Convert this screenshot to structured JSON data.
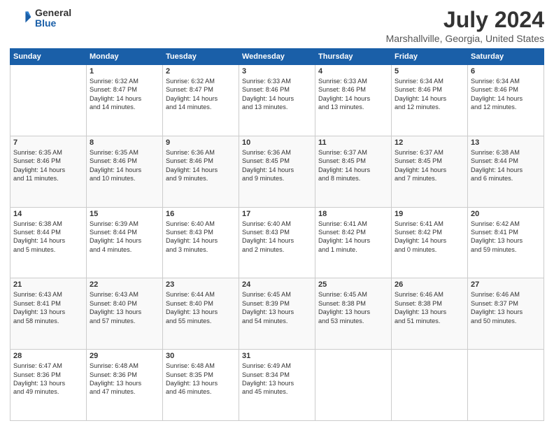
{
  "header": {
    "logo_general": "General",
    "logo_blue": "Blue",
    "title": "July 2024",
    "subtitle": "Marshallville, Georgia, United States"
  },
  "weekdays": [
    "Sunday",
    "Monday",
    "Tuesday",
    "Wednesday",
    "Thursday",
    "Friday",
    "Saturday"
  ],
  "weeks": [
    [
      {
        "day": "",
        "info": ""
      },
      {
        "day": "1",
        "info": "Sunrise: 6:32 AM\nSunset: 8:47 PM\nDaylight: 14 hours\nand 14 minutes."
      },
      {
        "day": "2",
        "info": "Sunrise: 6:32 AM\nSunset: 8:47 PM\nDaylight: 14 hours\nand 14 minutes."
      },
      {
        "day": "3",
        "info": "Sunrise: 6:33 AM\nSunset: 8:46 PM\nDaylight: 14 hours\nand 13 minutes."
      },
      {
        "day": "4",
        "info": "Sunrise: 6:33 AM\nSunset: 8:46 PM\nDaylight: 14 hours\nand 13 minutes."
      },
      {
        "day": "5",
        "info": "Sunrise: 6:34 AM\nSunset: 8:46 PM\nDaylight: 14 hours\nand 12 minutes."
      },
      {
        "day": "6",
        "info": "Sunrise: 6:34 AM\nSunset: 8:46 PM\nDaylight: 14 hours\nand 12 minutes."
      }
    ],
    [
      {
        "day": "7",
        "info": "Sunrise: 6:35 AM\nSunset: 8:46 PM\nDaylight: 14 hours\nand 11 minutes."
      },
      {
        "day": "8",
        "info": "Sunrise: 6:35 AM\nSunset: 8:46 PM\nDaylight: 14 hours\nand 10 minutes."
      },
      {
        "day": "9",
        "info": "Sunrise: 6:36 AM\nSunset: 8:46 PM\nDaylight: 14 hours\nand 9 minutes."
      },
      {
        "day": "10",
        "info": "Sunrise: 6:36 AM\nSunset: 8:45 PM\nDaylight: 14 hours\nand 9 minutes."
      },
      {
        "day": "11",
        "info": "Sunrise: 6:37 AM\nSunset: 8:45 PM\nDaylight: 14 hours\nand 8 minutes."
      },
      {
        "day": "12",
        "info": "Sunrise: 6:37 AM\nSunset: 8:45 PM\nDaylight: 14 hours\nand 7 minutes."
      },
      {
        "day": "13",
        "info": "Sunrise: 6:38 AM\nSunset: 8:44 PM\nDaylight: 14 hours\nand 6 minutes."
      }
    ],
    [
      {
        "day": "14",
        "info": "Sunrise: 6:38 AM\nSunset: 8:44 PM\nDaylight: 14 hours\nand 5 minutes."
      },
      {
        "day": "15",
        "info": "Sunrise: 6:39 AM\nSunset: 8:44 PM\nDaylight: 14 hours\nand 4 minutes."
      },
      {
        "day": "16",
        "info": "Sunrise: 6:40 AM\nSunset: 8:43 PM\nDaylight: 14 hours\nand 3 minutes."
      },
      {
        "day": "17",
        "info": "Sunrise: 6:40 AM\nSunset: 8:43 PM\nDaylight: 14 hours\nand 2 minutes."
      },
      {
        "day": "18",
        "info": "Sunrise: 6:41 AM\nSunset: 8:42 PM\nDaylight: 14 hours\nand 1 minute."
      },
      {
        "day": "19",
        "info": "Sunrise: 6:41 AM\nSunset: 8:42 PM\nDaylight: 14 hours\nand 0 minutes."
      },
      {
        "day": "20",
        "info": "Sunrise: 6:42 AM\nSunset: 8:41 PM\nDaylight: 13 hours\nand 59 minutes."
      }
    ],
    [
      {
        "day": "21",
        "info": "Sunrise: 6:43 AM\nSunset: 8:41 PM\nDaylight: 13 hours\nand 58 minutes."
      },
      {
        "day": "22",
        "info": "Sunrise: 6:43 AM\nSunset: 8:40 PM\nDaylight: 13 hours\nand 57 minutes."
      },
      {
        "day": "23",
        "info": "Sunrise: 6:44 AM\nSunset: 8:40 PM\nDaylight: 13 hours\nand 55 minutes."
      },
      {
        "day": "24",
        "info": "Sunrise: 6:45 AM\nSunset: 8:39 PM\nDaylight: 13 hours\nand 54 minutes."
      },
      {
        "day": "25",
        "info": "Sunrise: 6:45 AM\nSunset: 8:38 PM\nDaylight: 13 hours\nand 53 minutes."
      },
      {
        "day": "26",
        "info": "Sunrise: 6:46 AM\nSunset: 8:38 PM\nDaylight: 13 hours\nand 51 minutes."
      },
      {
        "day": "27",
        "info": "Sunrise: 6:46 AM\nSunset: 8:37 PM\nDaylight: 13 hours\nand 50 minutes."
      }
    ],
    [
      {
        "day": "28",
        "info": "Sunrise: 6:47 AM\nSunset: 8:36 PM\nDaylight: 13 hours\nand 49 minutes."
      },
      {
        "day": "29",
        "info": "Sunrise: 6:48 AM\nSunset: 8:36 PM\nDaylight: 13 hours\nand 47 minutes."
      },
      {
        "day": "30",
        "info": "Sunrise: 6:48 AM\nSunset: 8:35 PM\nDaylight: 13 hours\nand 46 minutes."
      },
      {
        "day": "31",
        "info": "Sunrise: 6:49 AM\nSunset: 8:34 PM\nDaylight: 13 hours\nand 45 minutes."
      },
      {
        "day": "",
        "info": ""
      },
      {
        "day": "",
        "info": ""
      },
      {
        "day": "",
        "info": ""
      }
    ]
  ]
}
